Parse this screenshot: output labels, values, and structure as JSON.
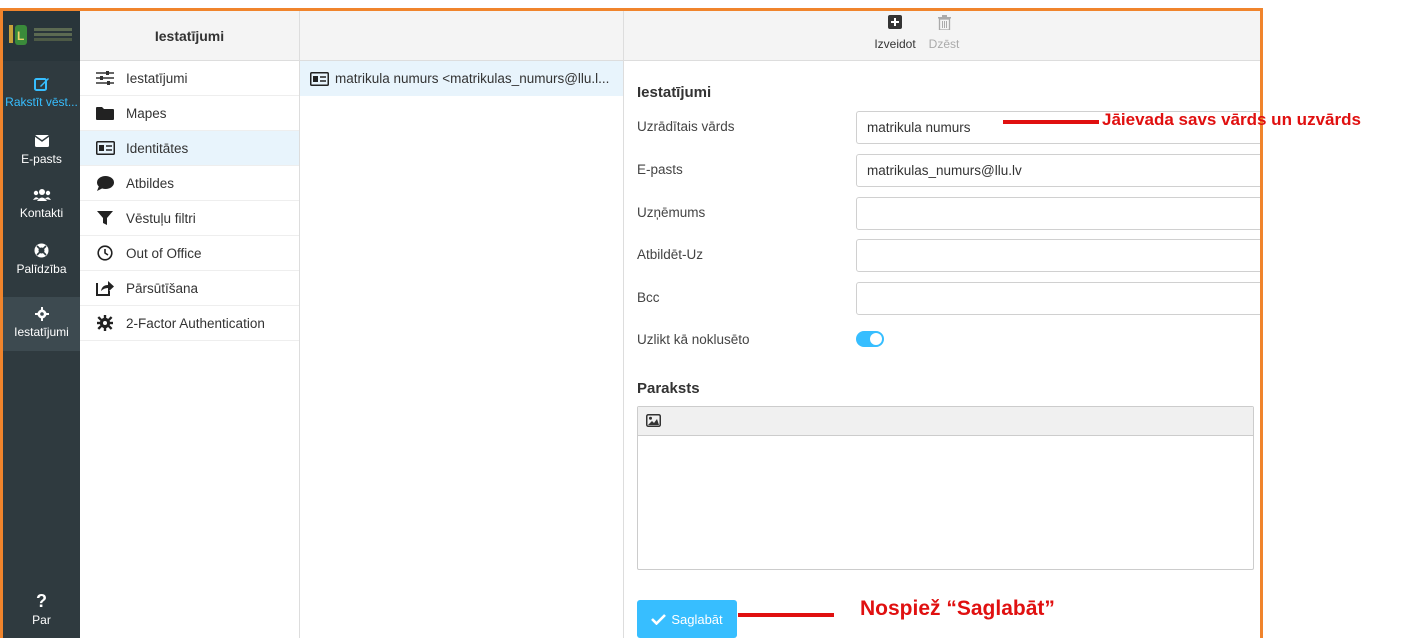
{
  "nav": {
    "items": [
      {
        "label": "Rakstīt vēst...",
        "icon": "compose-icon"
      },
      {
        "label": "E-pasts",
        "icon": "envelope-icon"
      },
      {
        "label": "Kontakti",
        "icon": "users-icon"
      },
      {
        "label": "Palīdzība",
        "icon": "help-circle-icon"
      },
      {
        "label": "Iestatījumi",
        "icon": "gear-icon"
      },
      {
        "label": "Par",
        "icon": "question-mark-icon"
      }
    ]
  },
  "settings": {
    "header": "Iestatījumi",
    "items": [
      {
        "label": "Iestatījumi",
        "icon": "sliders-icon"
      },
      {
        "label": "Mapes",
        "icon": "folder-icon"
      },
      {
        "label": "Identitātes",
        "icon": "id-card-icon"
      },
      {
        "label": "Atbildes",
        "icon": "speech-bubble-icon"
      },
      {
        "label": "Vēstuļu filtri",
        "icon": "filter-icon"
      },
      {
        "label": "Out of Office",
        "icon": "clock-icon"
      },
      {
        "label": "Pārsūtīšana",
        "icon": "forward-icon"
      },
      {
        "label": "2-Factor Authentication",
        "icon": "gear-icon"
      }
    ]
  },
  "identities": {
    "items": [
      {
        "label": "matrikula numurs <matrikulas_numurs@llu.l..."
      }
    ]
  },
  "toolbar": {
    "create_label": "Izveidot",
    "delete_label": "Dzēst"
  },
  "form": {
    "section_title": "Iestatījumi",
    "fields": {
      "display_name": {
        "label": "Uzrādītais vārds",
        "value": "matrikula numurs"
      },
      "email": {
        "label": "E-pasts",
        "value": "matrikulas_numurs@llu.lv"
      },
      "organization": {
        "label": "Uzņēmums",
        "value": ""
      },
      "reply_to": {
        "label": "Atbildēt-Uz",
        "value": ""
      },
      "bcc": {
        "label": "Bcc",
        "value": ""
      },
      "set_default": {
        "label": "Uzlikt kā noklusēto",
        "checked": true
      }
    },
    "signature_title": "Paraksts",
    "save_label": "Saglabāt"
  },
  "annotations": {
    "name_hint": "Jāievada savs vārds un uzvārds",
    "save_hint": "Nospiež “Saglabāt”",
    "color": "#e01010"
  },
  "colors": {
    "accent": "#37beff",
    "frame": "#f0842c",
    "nav_bg": "#2f3a3f"
  }
}
